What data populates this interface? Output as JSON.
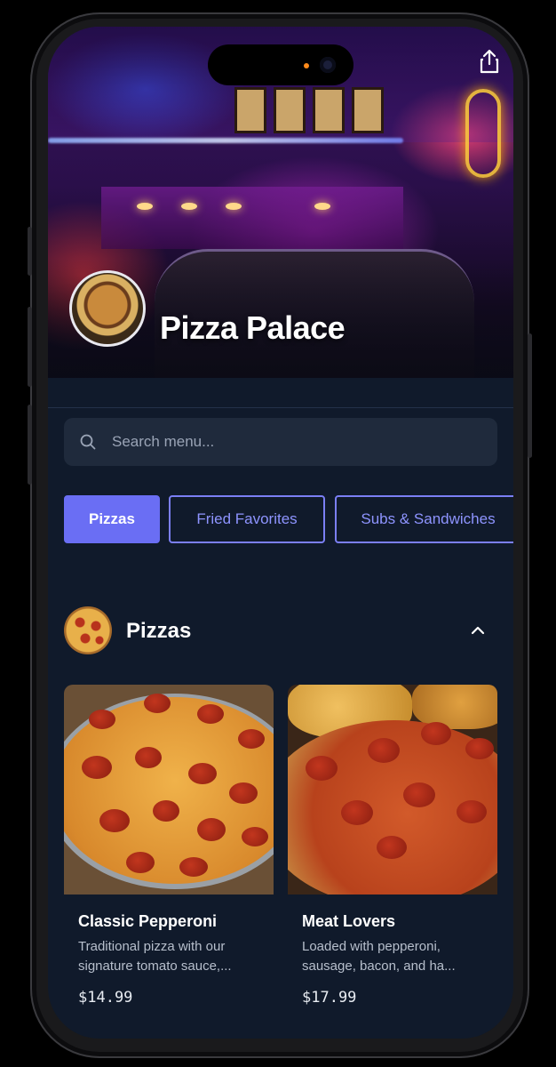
{
  "restaurant": {
    "name": "Pizza Palace"
  },
  "search": {
    "placeholder": "Search menu..."
  },
  "tabs": [
    {
      "label": "Pizzas",
      "active": true
    },
    {
      "label": "Fried Favorites",
      "active": false
    },
    {
      "label": "Subs & Sandwiches",
      "active": false
    }
  ],
  "section": {
    "title": "Pizzas",
    "expanded": true
  },
  "items": [
    {
      "name": "Classic Pepperoni",
      "description": "Traditional pizza with our signature tomato sauce,...",
      "price": "$14.99"
    },
    {
      "name": "Meat Lovers",
      "description": "Loaded with pepperoni, sausage, bacon, and ha...",
      "price": "$17.99"
    }
  ],
  "colors": {
    "accent": "#6a6ef4",
    "background": "#101a2b",
    "search_bg": "#1f2a3c"
  },
  "icons": [
    "share-icon",
    "search-icon",
    "chevron-up-icon"
  ]
}
